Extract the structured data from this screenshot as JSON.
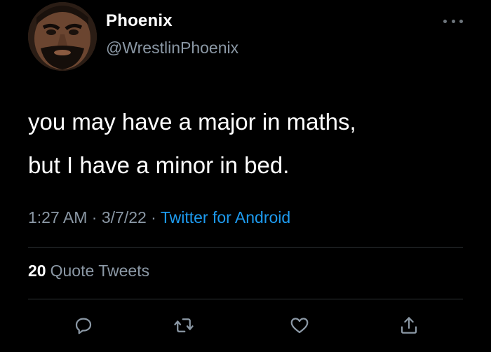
{
  "user": {
    "display_name": "Phoenix",
    "handle": "@WrestlinPhoenix",
    "avatar_icon": "profile-avatar"
  },
  "tweet": {
    "lines": [
      "you may have a major in maths,",
      "but I have a minor in bed."
    ]
  },
  "meta": {
    "time": "1:27 AM",
    "separator": " · ",
    "date": "3/7/22",
    "source": "Twitter for Android"
  },
  "stats": {
    "quote_count": "20",
    "quote_label": "Quote Tweets"
  },
  "actions": {
    "reply_icon": "reply-icon",
    "retweet_icon": "retweet-icon",
    "like_icon": "heart-icon",
    "share_icon": "share-icon"
  },
  "colors": {
    "background": "#000000",
    "text": "#ffffff",
    "secondary": "#8b98a5",
    "accent": "#1d9bf0",
    "divider": "#2f3336"
  }
}
